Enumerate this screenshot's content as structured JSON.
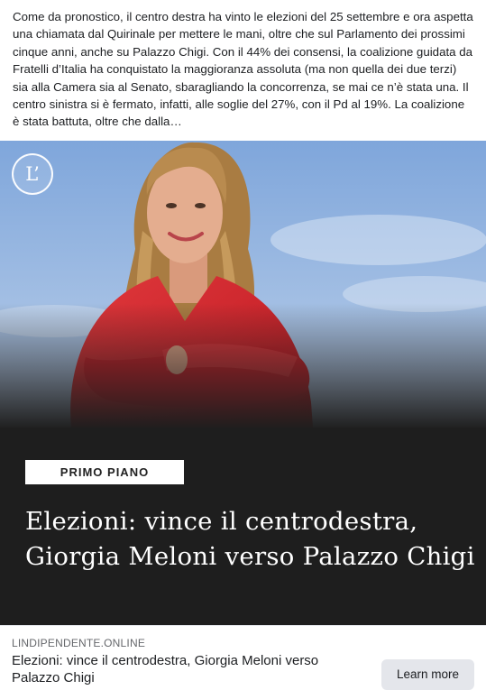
{
  "post": {
    "text": "Come da pronostico, il centro destra ha vinto le elezioni del 25 settembre e ora aspetta una chiamata dal Quirinale per mettere le mani, oltre che sul Parlamento dei prossimi cinque anni, anche su Palazzo Chigi. Con il 44% dei consensi, la coalizione guidata da Fratelli d’Italia ha conquistato la maggioranza assoluta (ma non quella dei due terzi) sia alla Camera sia al Senato, sbaragliando la concorrenza, se mai ce n’è stata una. Il centro sinistra si è fermato, infatti, alle soglie del 27%, con il Pd al 19%. La coalizione è stata battuta, oltre che dalla…"
  },
  "hero": {
    "logo_text": "L’",
    "tag": "PRIMO PIANO",
    "headline": "Elezioni: vince il centrodestra, Giorgia Meloni verso Palazzo Chigi"
  },
  "link": {
    "domain": "LINDIPENDENTE.ONLINE",
    "title": "Elezioni: vince il centrodestra, Giorgia Meloni verso Palazzo Chigi",
    "cta": "Learn more"
  },
  "colors": {
    "sky_top": "#8fb3e2",
    "sky_bottom": "#dfe7f1",
    "jacket": "#d9252d",
    "hair": "#a87d45",
    "skin": "#e2aa8c",
    "overlay": "#1e1e1e",
    "button_bg": "#e4e6eb"
  }
}
